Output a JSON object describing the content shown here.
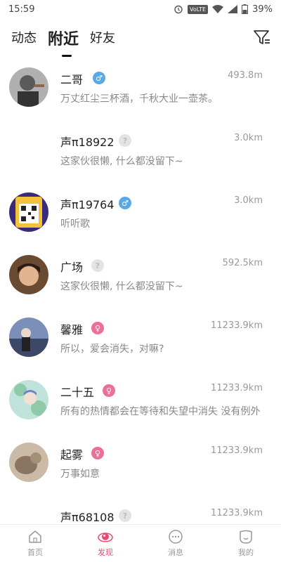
{
  "status_bar": {
    "time": "15:59",
    "network": "VoLTE",
    "battery": "39%",
    "icons": [
      "alarm-icon",
      "wifi-icon",
      "signal-icon",
      "battery-icon"
    ]
  },
  "tabs": [
    {
      "label": "动态",
      "active": false
    },
    {
      "label": "附近",
      "active": true
    },
    {
      "label": "好友",
      "active": false
    }
  ],
  "filter_icon": "filter-icon",
  "users": [
    {
      "name": "二哥",
      "gender": "male",
      "gender_symbol": "♂",
      "distance": "493.8m",
      "signature": "万丈红尘三杯酒，千秋大业一壶茶。",
      "avatar": "photo"
    },
    {
      "name": "声π18922",
      "gender": "unknown",
      "gender_symbol": "?",
      "distance": "3.0km",
      "signature": "这家伙很懒, 什么都没留下~",
      "avatar": "none"
    },
    {
      "name": "声π19764",
      "gender": "male",
      "gender_symbol": "♂",
      "distance": "3.0km",
      "signature": "听听歌",
      "avatar": "qr"
    },
    {
      "name": "广场",
      "gender": "unknown",
      "gender_symbol": "?",
      "distance": "592.5km",
      "signature": "这家伙很懒, 什么都没留下~",
      "avatar": "photo"
    },
    {
      "name": "馨雅",
      "gender": "female",
      "gender_symbol": "♀",
      "distance": "11233.9km",
      "signature": "所以，爱会消失，对嘛?",
      "avatar": "photo"
    },
    {
      "name": "二十五",
      "gender": "female",
      "gender_symbol": "♀",
      "distance": "11233.9km",
      "signature": "所有的热情都会在等待和失望中消失 没有例外",
      "avatar": "photo"
    },
    {
      "name": "起雾",
      "gender": "female",
      "gender_symbol": "♀",
      "distance": "11233.9km",
      "signature": "万事如意",
      "avatar": "photo"
    },
    {
      "name": "声π68108",
      "gender": "unknown",
      "gender_symbol": "?",
      "distance": "11233.9km",
      "signature": "",
      "avatar": "none"
    }
  ],
  "bottom_nav": [
    {
      "label": "首页",
      "icon": "home-icon",
      "active": false
    },
    {
      "label": "发现",
      "icon": "discover-icon",
      "active": true
    },
    {
      "label": "消息",
      "icon": "message-icon",
      "active": false
    },
    {
      "label": "我的",
      "icon": "profile-icon",
      "active": false
    }
  ],
  "colors": {
    "male": "#5aa9e6",
    "female": "#ec6f9a",
    "unknown": "#e3e3e3",
    "accent": "#e94b6f"
  }
}
